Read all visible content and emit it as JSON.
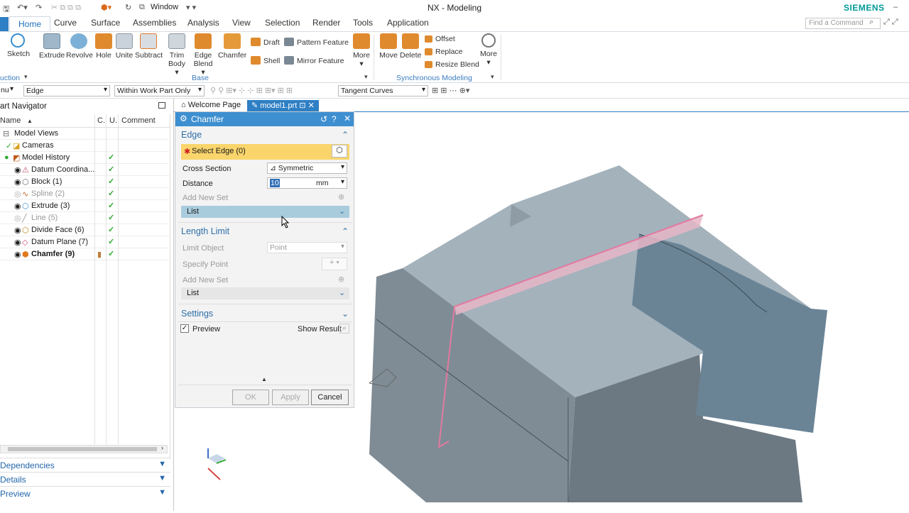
{
  "titlebar": {
    "window_menu": "Window",
    "app_title": "NX - Modeling",
    "brand": "SIEMENS"
  },
  "tabs": [
    "Home",
    "Curve",
    "Surface",
    "Assemblies",
    "Analysis",
    "View",
    "Selection",
    "Render",
    "Tools",
    "Application"
  ],
  "find_command_placeholder": "Find a Command",
  "ribbon": {
    "sketch": "Sketch",
    "construction": "uction",
    "extrude": "Extrude",
    "revolve": "Revolve",
    "hole": "Hole",
    "unite": "Unite",
    "subtract": "Subtract",
    "trim": "Trim",
    "body": "Body",
    "edge": "Edge",
    "blend": "Blend",
    "chamfer": "Chamfer",
    "draft": "Draft",
    "shell": "Shell",
    "pattern_feature": "Pattern Feature",
    "mirror_feature": "Mirror Feature",
    "more": "More",
    "base": "Base",
    "move": "Move",
    "delete": "Delete",
    "offset": "Offset",
    "replace": "Replace",
    "resize_blend": "Resize Blend",
    "synchronous_modeling": "Synchronous Modeling"
  },
  "filterbar": {
    "menu": "nu",
    "type_filter": "Edge",
    "scope": "Within Work Part Only",
    "curve_rule": "Tangent Curves"
  },
  "navigator": {
    "title": "art Navigator",
    "columns": {
      "name": "Name",
      "c": "C.",
      "u": "U.",
      "comment": "Comment"
    },
    "items": [
      {
        "label": "Model Views",
        "check": ""
      },
      {
        "label": "Cameras",
        "check": ""
      },
      {
        "label": "Model History",
        "check": "✓"
      },
      {
        "label": "Datum Coordina...",
        "check": "✓"
      },
      {
        "label": "Block (1)",
        "check": "✓"
      },
      {
        "label": "Spline (2)",
        "check": "✓"
      },
      {
        "label": "Extrude (3)",
        "check": "✓"
      },
      {
        "label": "Line (5)",
        "check": "✓"
      },
      {
        "label": "Divide Face (6)",
        "check": "✓"
      },
      {
        "label": "Datum Plane (7)",
        "check": "✓"
      },
      {
        "label": "Chamfer (9)",
        "check": "✓"
      }
    ],
    "accordions": [
      "Dependencies",
      "Details",
      "Preview"
    ]
  },
  "doc_tabs": {
    "welcome": "Welcome Page",
    "model": "model1.prt"
  },
  "dialog": {
    "title": "Chamfer",
    "edge_section": "Edge",
    "select_edge": "Select Edge (0)",
    "cross_section_label": "Cross Section",
    "cross_section_value": "Symmetric",
    "distance_label": "Distance",
    "distance_value": "10",
    "distance_unit": "mm",
    "add_new_set": "Add New Set",
    "list": "List",
    "length_limit": "Length Limit",
    "limit_object_label": "Limit Object",
    "limit_object_value": "Point",
    "specify_point": "Specify Point",
    "settings": "Settings",
    "preview": "Preview",
    "show_result": "Show Result",
    "ok": "OK",
    "apply": "Apply",
    "cancel": "Cancel"
  }
}
